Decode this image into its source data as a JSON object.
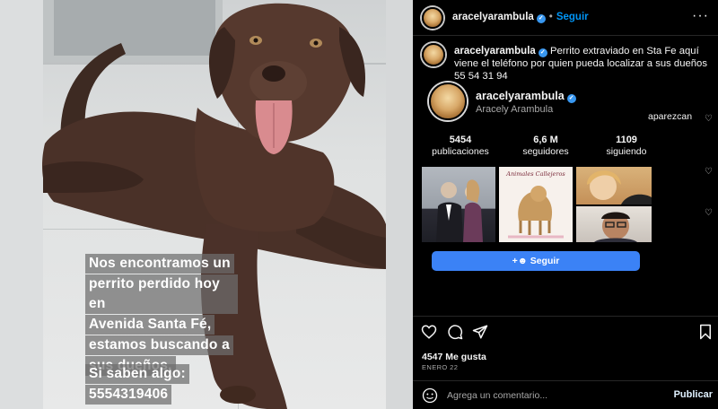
{
  "story": {
    "lines_1": [
      "Nos encontramos un",
      "perrito perdido hoy en",
      "Avenida Santa Fé,",
      "estamos buscando a",
      "sus dueños."
    ],
    "lines_2": [
      "Si saben algo:",
      "5554319406"
    ]
  },
  "header": {
    "username": "aracelyarambula",
    "follow_label": "Seguir",
    "verified_glyph": "✓",
    "more_glyph": "···"
  },
  "caption": {
    "username": "aracelyarambula",
    "text": "Perrito extraviado en Sta Fe aquí viene el teléfono por quien pueda localizar a sus dueños 55 54 31 94"
  },
  "embed": {
    "username": "aracelyarambula",
    "full_name": "Aracely Arambula",
    "comment_fragment": "aparezcan",
    "stats": [
      {
        "value": "5454",
        "label": "publicaciones"
      },
      {
        "value": "6,6 M",
        "label": "seguidores"
      },
      {
        "value": "1109",
        "label": "siguiendo"
      }
    ],
    "thumb_2_title": "Animales Callejeros",
    "follow_button": "Seguir"
  },
  "actions": {
    "icons": [
      "heart-icon",
      "comment-icon",
      "share-icon",
      "bookmark-icon"
    ],
    "likes": "4547 Me gusta",
    "date": "ENERO 22"
  },
  "comment_box": {
    "placeholder": "Agrega un comentario...",
    "publish_label": "Publicar"
  },
  "colors": {
    "accent_blue": "#0095f6",
    "button_blue": "#3b82f6",
    "panel_bg": "#000000"
  }
}
